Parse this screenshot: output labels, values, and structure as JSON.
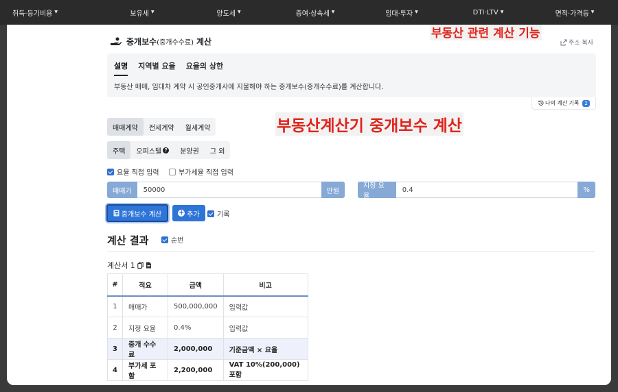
{
  "nav": {
    "items": [
      "취득·등기비용",
      "보유세",
      "양도세",
      "증여·상속세",
      "임대·투자",
      "DTI·LTV",
      "면적·가격등"
    ]
  },
  "header": {
    "title_main": "중개보수",
    "title_sub": "(중개수수료)",
    "title_suffix": "계산",
    "copy_address": "주소 복사"
  },
  "overlays": {
    "top": "부동산 관련 계산 기능",
    "middle": "부동산계산기 중개보수 계산"
  },
  "info": {
    "tabs": [
      "설명",
      "지역별 요율",
      "요율의 상한"
    ],
    "active_tab": 0,
    "description": "부동산 매매, 임대차 계약 시 공인중개사에 지불해야 하는 중개보수(중개수수료)를 계산합니다.",
    "history_label": "나의 계산 기록",
    "history_count": "2"
  },
  "contract_types": [
    "매매계약",
    "전세계약",
    "월세계약"
  ],
  "property_types": [
    "주택",
    "오피스텔",
    "분양권",
    "그 외"
  ],
  "options": {
    "direct_rate": {
      "label": "요율 직접 입력",
      "checked": true
    },
    "direct_vat": {
      "label": "부가세율 직접 입력",
      "checked": false
    }
  },
  "price_input": {
    "prefix": "매매가",
    "value": "50000",
    "suffix": "만원"
  },
  "rate_input": {
    "prefix": "지정 요율",
    "value": "0.4",
    "suffix": "%"
  },
  "actions": {
    "calc_label": "중개보수 계산",
    "add_label": "추가",
    "record_label": "기록",
    "record_checked": true
  },
  "result": {
    "title": "계산 결과",
    "order_label": "순번",
    "doc_title": "계산서 1",
    "columns": [
      "#",
      "적요",
      "금액",
      "비고"
    ],
    "rows": [
      [
        "1",
        "매매가",
        "500,000,000",
        "입력값"
      ],
      [
        "2",
        "지정 요율",
        "0.4%",
        "입력값"
      ],
      [
        "3",
        "중개 수수료",
        "2,000,000",
        "기준금액 × 요율"
      ],
      [
        "4",
        "부가세 포함",
        "2,200,000",
        "VAT 10%(200,000) 포함"
      ]
    ]
  },
  "colors": {
    "nav_bg": "#2b2b2b",
    "accent": "#2f75d8",
    "addon": "#86a9d6",
    "overlay_text": "#e0241b",
    "highlight_row": "#eef1fb"
  }
}
